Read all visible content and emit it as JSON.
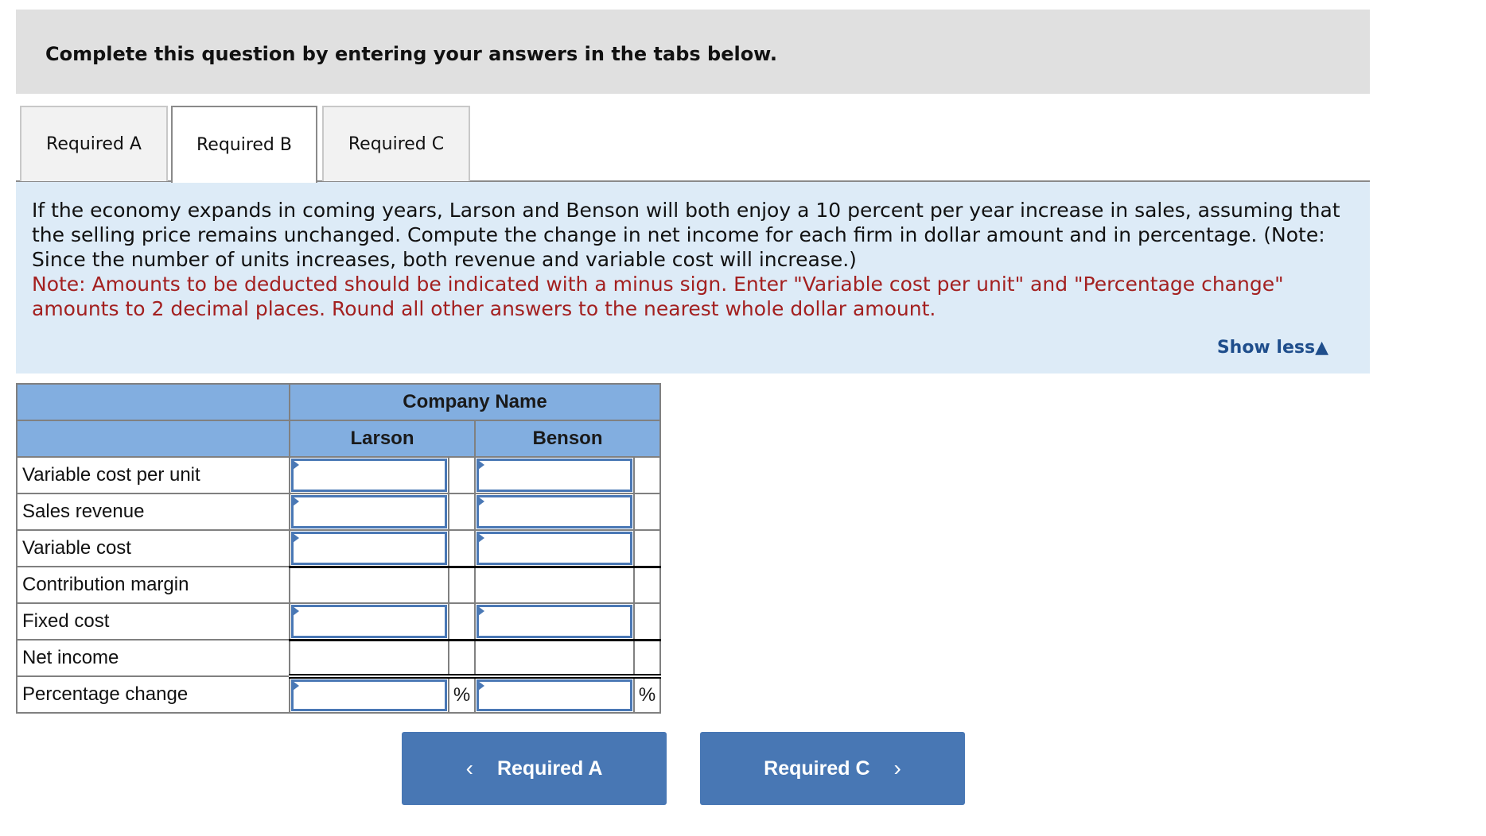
{
  "instructions": "Complete this question by entering your answers in the tabs below.",
  "tabs": [
    {
      "label": "Required A",
      "active": false
    },
    {
      "label": "Required B",
      "active": true
    },
    {
      "label": "Required C",
      "active": false
    }
  ],
  "question": {
    "text": "If the economy expands in coming years, Larson and Benson will both enjoy a 10 percent per year increase in sales, assuming that the selling price remains unchanged. Compute the change in net income for each firm in dollar amount and in percentage. (Note: Since the number of units increases, both revenue and variable cost will increase.)",
    "note": "Note: Amounts to be deducted should be indicated with a minus sign. Enter \"Variable cost per unit\" and \"Percentage change\" amounts to 2 decimal places. Round all other answers to the nearest whole dollar amount.",
    "toggle_label": "Show less",
    "toggle_icon": "▲"
  },
  "table": {
    "group_header": "Company Name",
    "columns": [
      "Larson",
      "Benson"
    ],
    "rows": [
      {
        "label": "Variable cost per unit",
        "larson": "",
        "benson": "",
        "editable": true,
        "suffix": ""
      },
      {
        "label": "Sales revenue",
        "larson": "",
        "benson": "",
        "editable": true,
        "suffix": ""
      },
      {
        "label": "Variable cost",
        "larson": "",
        "benson": "",
        "editable": true,
        "suffix": ""
      },
      {
        "label": "Contribution margin",
        "larson": "",
        "benson": "",
        "editable": false,
        "suffix": ""
      },
      {
        "label": "Fixed cost",
        "larson": "",
        "benson": "",
        "editable": true,
        "suffix": ""
      },
      {
        "label": "Net income",
        "larson": "",
        "benson": "",
        "editable": false,
        "suffix": ""
      },
      {
        "label": "Percentage change",
        "larson": "",
        "benson": "",
        "editable": true,
        "suffix": "%"
      }
    ]
  },
  "nav": {
    "prev_label": "Required A",
    "prev_icon": "‹",
    "next_label": "Required C",
    "next_icon": "›"
  }
}
